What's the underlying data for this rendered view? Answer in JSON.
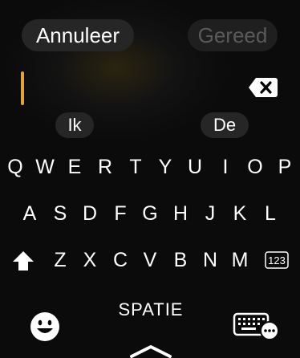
{
  "header": {
    "cancel_label": "Annuleer",
    "done_label": "Gereed"
  },
  "suggestions": [
    "Ik",
    "De"
  ],
  "keyboard": {
    "row1": [
      "Q",
      "W",
      "E",
      "R",
      "T",
      "Y",
      "U",
      "I",
      "O",
      "P"
    ],
    "row2": [
      "A",
      "S",
      "D",
      "F",
      "G",
      "H",
      "J",
      "K",
      "L"
    ],
    "row3": [
      "Z",
      "X",
      "C",
      "V",
      "B",
      "N",
      "M"
    ],
    "space_label": "SPATIE",
    "numbers_label": "123",
    "icons": {
      "shift": "shift-icon",
      "backspace": "backspace-icon",
      "emoji": "emoji-icon",
      "keyboard": "keyboard-more-icon",
      "expand": "chevron-up-icon"
    }
  },
  "colors": {
    "cursor": "#e0a43a",
    "pill": "#262626",
    "done_text": "#5a5a5a"
  }
}
